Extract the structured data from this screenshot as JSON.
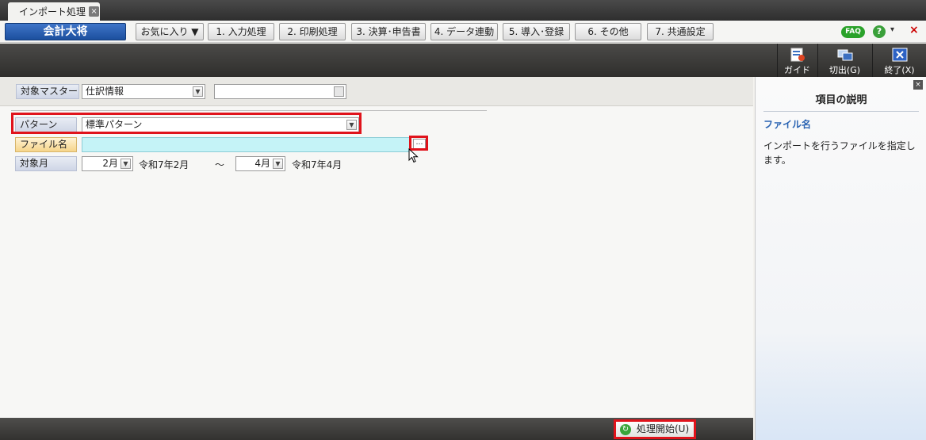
{
  "tab": {
    "label": "インポート処理",
    "close_label": "×"
  },
  "menubar": {
    "brand": "会計大将",
    "items": [
      {
        "label": "お気に入り ▼"
      },
      {
        "label": "1. 入力処理"
      },
      {
        "label": "2. 印刷処理"
      },
      {
        "label": "3. 決算･申告書"
      },
      {
        "label": "4. データ連動"
      },
      {
        "label": "5. 導入･登録"
      },
      {
        "label": "6. その他"
      },
      {
        "label": "7. 共通設定"
      }
    ],
    "faq": "FAQ",
    "help": "?",
    "help_dropdown": "▾",
    "close": "×"
  },
  "toolbar": {
    "guide": "ガイド",
    "cut": "切出(G)",
    "exit": "終了(X)"
  },
  "form": {
    "master_label": "対象マスター",
    "master_value": "仕訳情報",
    "master_extra": "",
    "pattern_label": "パターン",
    "pattern_value": "標準パターン",
    "file_label": "ファイル名",
    "file_value": "",
    "file_browse": "…",
    "month_label": "対象月",
    "month_from": "2月",
    "month_from_era": "令和7年2月",
    "range_sep": "～",
    "month_to": "4月",
    "month_to_era": "令和7年4月"
  },
  "start_button": {
    "label": "処理開始(U)"
  },
  "panel": {
    "title": "項目の説明",
    "heading": "ファイル名",
    "text": "インポートを行うファイルを指定します。"
  },
  "colors": {
    "accent_red": "#e0131b",
    "brand_blue": "#1c4f9e",
    "file_highlight": "#c5f3f7"
  }
}
